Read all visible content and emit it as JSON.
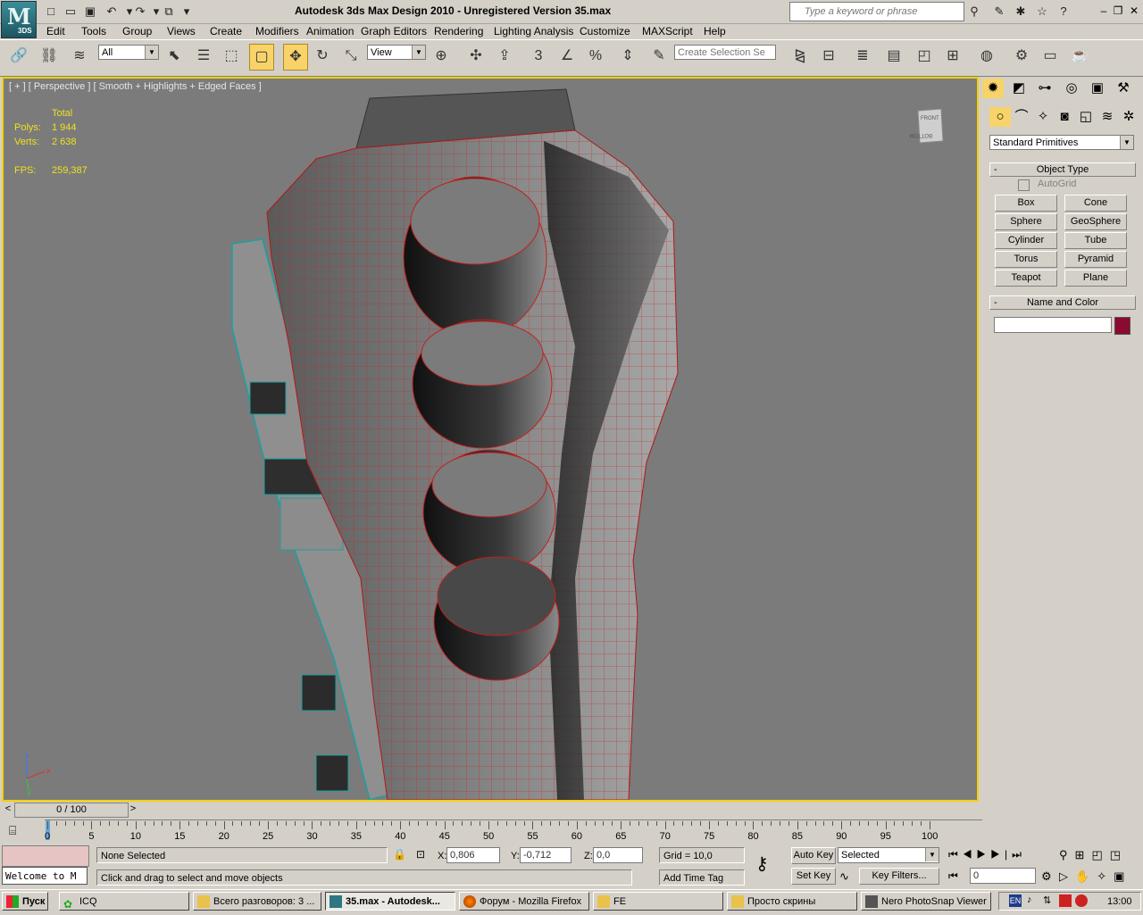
{
  "app": {
    "logo_letter": "M",
    "logo_sub": "3DS",
    "title": "Autodesk 3ds Max Design 2010  - Unregistered Version    35.max",
    "search_placeholder": "Type a keyword or phrase"
  },
  "menu": [
    "Edit",
    "Tools",
    "Group",
    "Views",
    "Create",
    "Modifiers",
    "Animation",
    "Graph Editors",
    "Rendering",
    "Lighting Analysis",
    "Customize",
    "MAXScript",
    "Help"
  ],
  "toolbar": {
    "selection_filter": "All",
    "reference_coord": "View",
    "named_selection_placeholder": "Create Selection Se"
  },
  "viewport": {
    "label": "[ + ] [ Perspective ] [ Smooth + Highlights + Edged Faces ]",
    "stats": {
      "total_label": "Total",
      "polys_label": "Polys:",
      "polys_value": "1 944",
      "verts_label": "Verts:",
      "verts_value": "2 638",
      "fps_label": "FPS:",
      "fps_value": "259,387"
    },
    "viewcube_top": "FRONT",
    "viewcube_bottom": "BOTTOM"
  },
  "command_panel": {
    "category": "Standard Primitives",
    "object_type_header": "Object Type",
    "autogrid_label": "AutoGrid",
    "buttons": [
      "Box",
      "Cone",
      "Sphere",
      "GeoSphere",
      "Cylinder",
      "Tube",
      "Torus",
      "Pyramid",
      "Teapot",
      "Plane"
    ],
    "name_color_header": "Name and Color",
    "object_color": "#8b0a32",
    "rollout_minus": "-"
  },
  "timeline": {
    "slider_text": "0 / 100",
    "ticks": [
      "0",
      "5",
      "10",
      "15",
      "20",
      "25",
      "30",
      "35",
      "40",
      "45",
      "50",
      "55",
      "60",
      "65",
      "70",
      "75",
      "80",
      "85",
      "90",
      "95",
      "100"
    ]
  },
  "status": {
    "welcome": "Welcome to M",
    "selection": "None Selected",
    "prompt": "Click and drag to select and move objects",
    "x_label": "X:",
    "x_value": "0,806",
    "y_label": "Y:",
    "y_value": "-0,712",
    "z_label": "Z:",
    "z_value": "0,0",
    "grid": "Grid = 10,0",
    "add_time_tag": "Add Time Tag",
    "auto_key": "Auto Key",
    "set_key": "Set Key",
    "key_mode": "Selected",
    "key_filters": "Key Filters...",
    "frame": "0"
  },
  "taskbar": {
    "start": "Пуск",
    "tasks": [
      "ICQ",
      "Всего разговоров: 3 ...",
      "35.max - Autodesk...",
      "Форум - Mozilla Firefox",
      "FE",
      "Просто скрины",
      "Nero PhotoSnap Viewer"
    ],
    "lang": "EN",
    "time": "13:00"
  }
}
